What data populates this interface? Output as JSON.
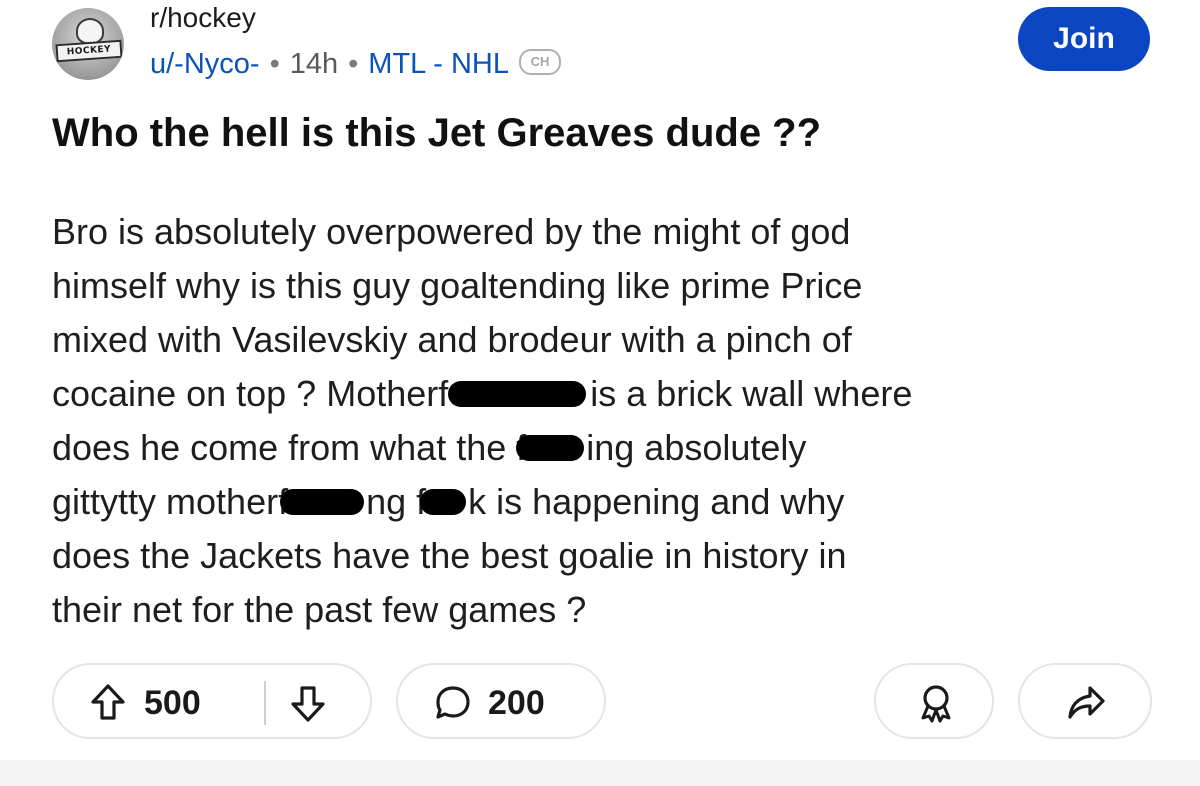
{
  "header": {
    "subreddit": "r/hockey",
    "avatar_text": "HOCKEY",
    "author": "u/-Nyco-",
    "separator": "•",
    "time_ago": "14h",
    "flair": "MTL - NHL",
    "flair_icon_text": "CH",
    "join_label": "Join"
  },
  "post": {
    "title": "Who the hell is this Jet Greaves dude ??",
    "body_lines": [
      "Bro is absolutely overpowered by the might of god",
      "himself why is this guy goaltending like prime Price",
      "mixed with Vasilevskiy and brodeur with a pinch of",
      [
        "cocaine on top ? Motherf",
        "is a brick wall where"
      ],
      [
        "does he come from what the f",
        "ing absolutely"
      ],
      [
        "gittytty motherf",
        "ng f",
        "k is happening and why"
      ],
      "does the Jackets have the best goalie in history in",
      "their net for the past few games ?"
    ]
  },
  "actions": {
    "upvotes": "500",
    "comments": "200"
  },
  "colors": {
    "join_bg": "#0a45c2",
    "link_blue": "#0a54b8",
    "censor": "#000000"
  },
  "icons": [
    "upvote-icon",
    "downvote-icon",
    "comment-icon",
    "award-icon",
    "share-icon"
  ]
}
